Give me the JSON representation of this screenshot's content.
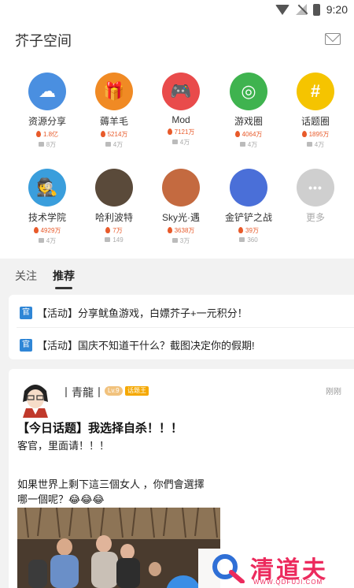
{
  "statusbar": {
    "time": "9:20"
  },
  "header": {
    "title": "芥子空间"
  },
  "categories": [
    {
      "name": "资源分享",
      "heat": "1.8亿",
      "count": "8万",
      "color": "#4a8fe0",
      "icon": "cloud-upload-icon",
      "glyph": "☁"
    },
    {
      "name": "薅羊毛",
      "heat": "5214万",
      "count": "4万",
      "color": "#f08a24",
      "icon": "gift-icon",
      "glyph": "🎁"
    },
    {
      "name": "Mod",
      "heat": "7121万",
      "count": "4万",
      "color": "#e94b4b",
      "icon": "gamepad-icon",
      "glyph": "🎮"
    },
    {
      "name": "游戏圈",
      "heat": "4064万",
      "count": "4万",
      "color": "#3fb34f",
      "icon": "circle-logo-icon",
      "glyph": "◎"
    },
    {
      "name": "话题圈",
      "heat": "1895万",
      "count": "4万",
      "color": "#f5c400",
      "icon": "user-tag-icon",
      "glyph": "#"
    },
    {
      "name": "技术学院",
      "heat": "4929万",
      "count": "4万",
      "color": "#3a9edc",
      "icon": "spy-icon",
      "glyph": "🕵"
    },
    {
      "name": "哈利波特",
      "heat": "7万",
      "count": "149",
      "color": "#5a4a3a",
      "icon": "harry-potter-avatar",
      "glyph": ""
    },
    {
      "name": "Sky光·遇",
      "heat": "3638万",
      "count": "3万",
      "color": "#c46a40",
      "icon": "sky-avatar",
      "glyph": ""
    },
    {
      "name": "金铲铲之战",
      "heat": "39万",
      "count": "360",
      "color": "#4a6fd8",
      "icon": "tft-avatar",
      "glyph": ""
    },
    {
      "name": "更多",
      "heat": "",
      "count": "",
      "color": "#cfcfcf",
      "icon": "more-icon",
      "glyph": "•••"
    }
  ],
  "tabs": [
    {
      "label": "关注"
    },
    {
      "label": "推荐"
    }
  ],
  "announcements": [
    {
      "tag": "官",
      "text": "【活动】分享鱿鱼游戏，白嫖芥子+一元积分！"
    },
    {
      "tag": "官",
      "text": "【活动】国庆不知道干什么？截图决定你的假期!"
    }
  ],
  "post": {
    "username": "丨青龍丨",
    "level": "Lv.9",
    "badge": "话题王",
    "time": "刚刚",
    "title": "【今日话题】我选择自杀！！！",
    "line1": "客官，里面请！！！",
    "line2": "如果世界上剩下這三個女人 ，你們會選擇",
    "line3": "哪一個呢？😂😂😂"
  },
  "watermark": {
    "text": "清道夫",
    "sub": "WWW.QDFUJI.COM"
  }
}
